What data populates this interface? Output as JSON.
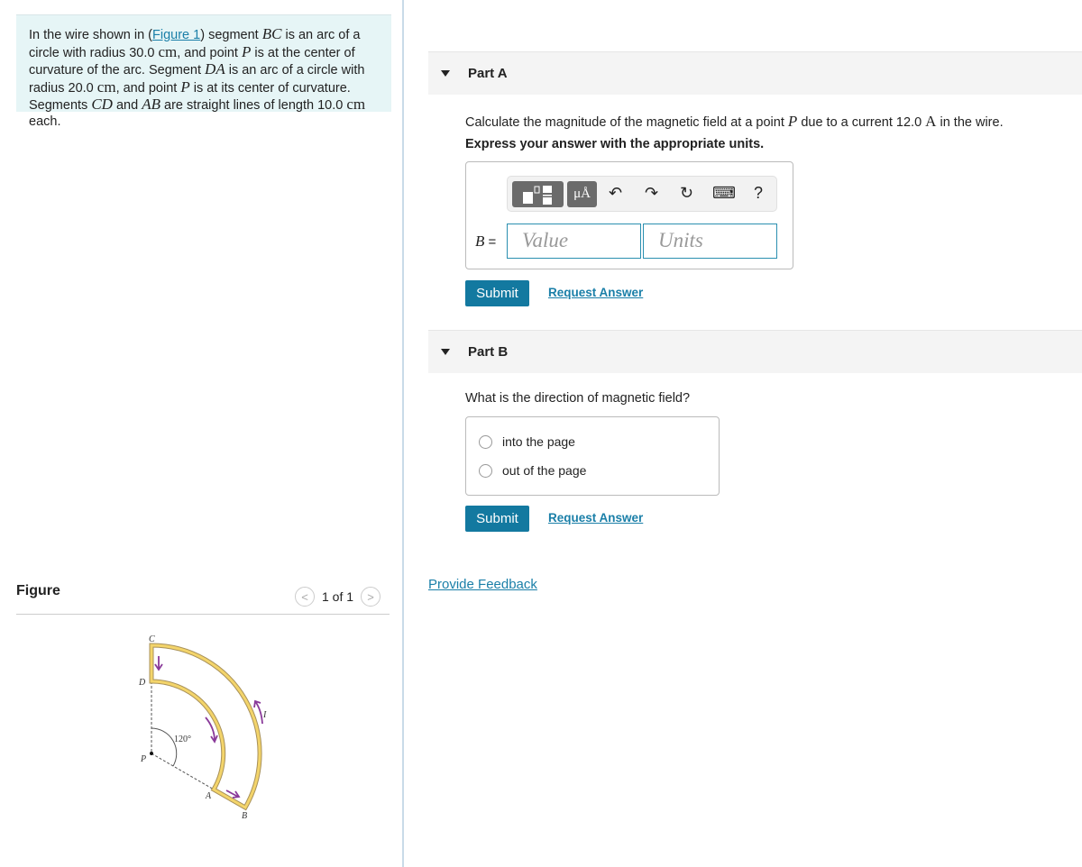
{
  "intro": {
    "t1": "In the wire shown in (",
    "figure_link": "Figure 1",
    "t2": ") segment ",
    "m1": "BC",
    "t3": " is an arc of a circle with radius 30.0 ",
    "u1": "cm",
    "t4": ", and point ",
    "m2": "P",
    "t5": " is at the center of curvature of the arc. Segment ",
    "m3": "DA",
    "t6": " is an arc of a circle with radius 20.0 ",
    "u2": "cm",
    "t7": ", and point ",
    "m4": "P",
    "t8": " is at its center of curvature. Segments ",
    "m5": "CD",
    "t9": " and ",
    "m6": "AB",
    "t10": " are straight lines of length 10.0 ",
    "u3": "cm",
    "t11": " each."
  },
  "figure": {
    "title": "Figure",
    "pager": "1 of 1",
    "labels": {
      "C": "C",
      "D": "D",
      "P": "P",
      "A": "A",
      "B": "B",
      "I": "I",
      "angle": "120°"
    },
    "wire_color": "#e8c65a",
    "arrow_color": "#8a3a9a"
  },
  "partA": {
    "title": "Part A",
    "q1": "Calculate the magnitude of the magnetic field at a point ",
    "qm": "P",
    "q2": " due to a current 12.0 ",
    "qu": "A",
    "q3": " in the wire.",
    "instruction": "Express your answer with the appropriate units.",
    "toolbar": {
      "units_btn": "μÅ",
      "undo": "↶",
      "redo": "↷",
      "reset": "↻",
      "keyboard": "⌨",
      "help": "?"
    },
    "var_label": "B",
    "eq": " =",
    "value_placeholder": "Value",
    "units_placeholder": "Units",
    "submit": "Submit",
    "request": "Request Answer"
  },
  "partB": {
    "title": "Part B",
    "question": "What is the direction of magnetic field?",
    "options": [
      "into the page",
      "out of the page"
    ],
    "submit": "Submit",
    "request": "Request Answer"
  },
  "feedback": "Provide Feedback",
  "colors": {
    "accent": "#1379a0",
    "intro_bg": "#e6f5f6"
  }
}
